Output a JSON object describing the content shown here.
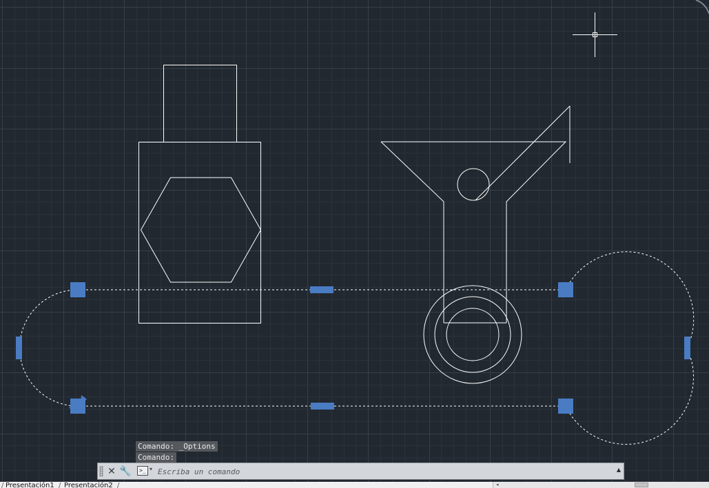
{
  "command_history": [
    "Comando: _Options",
    "Comando:"
  ],
  "command_line": {
    "placeholder": "Escriba un comando",
    "close_symbol": "✕",
    "customize_symbol": "🔧",
    "prompt_symbol": ">_",
    "recent_symbol": "▾",
    "history_toggle_symbol": "▲"
  },
  "layout_tabs": [
    "Presentación1",
    "Presentación2"
  ],
  "colors": {
    "background": "#212830",
    "grid_minor": "#2b323b",
    "grid_major": "#364049",
    "geometry": "#ffffff",
    "grip": "#4a7cc4"
  }
}
